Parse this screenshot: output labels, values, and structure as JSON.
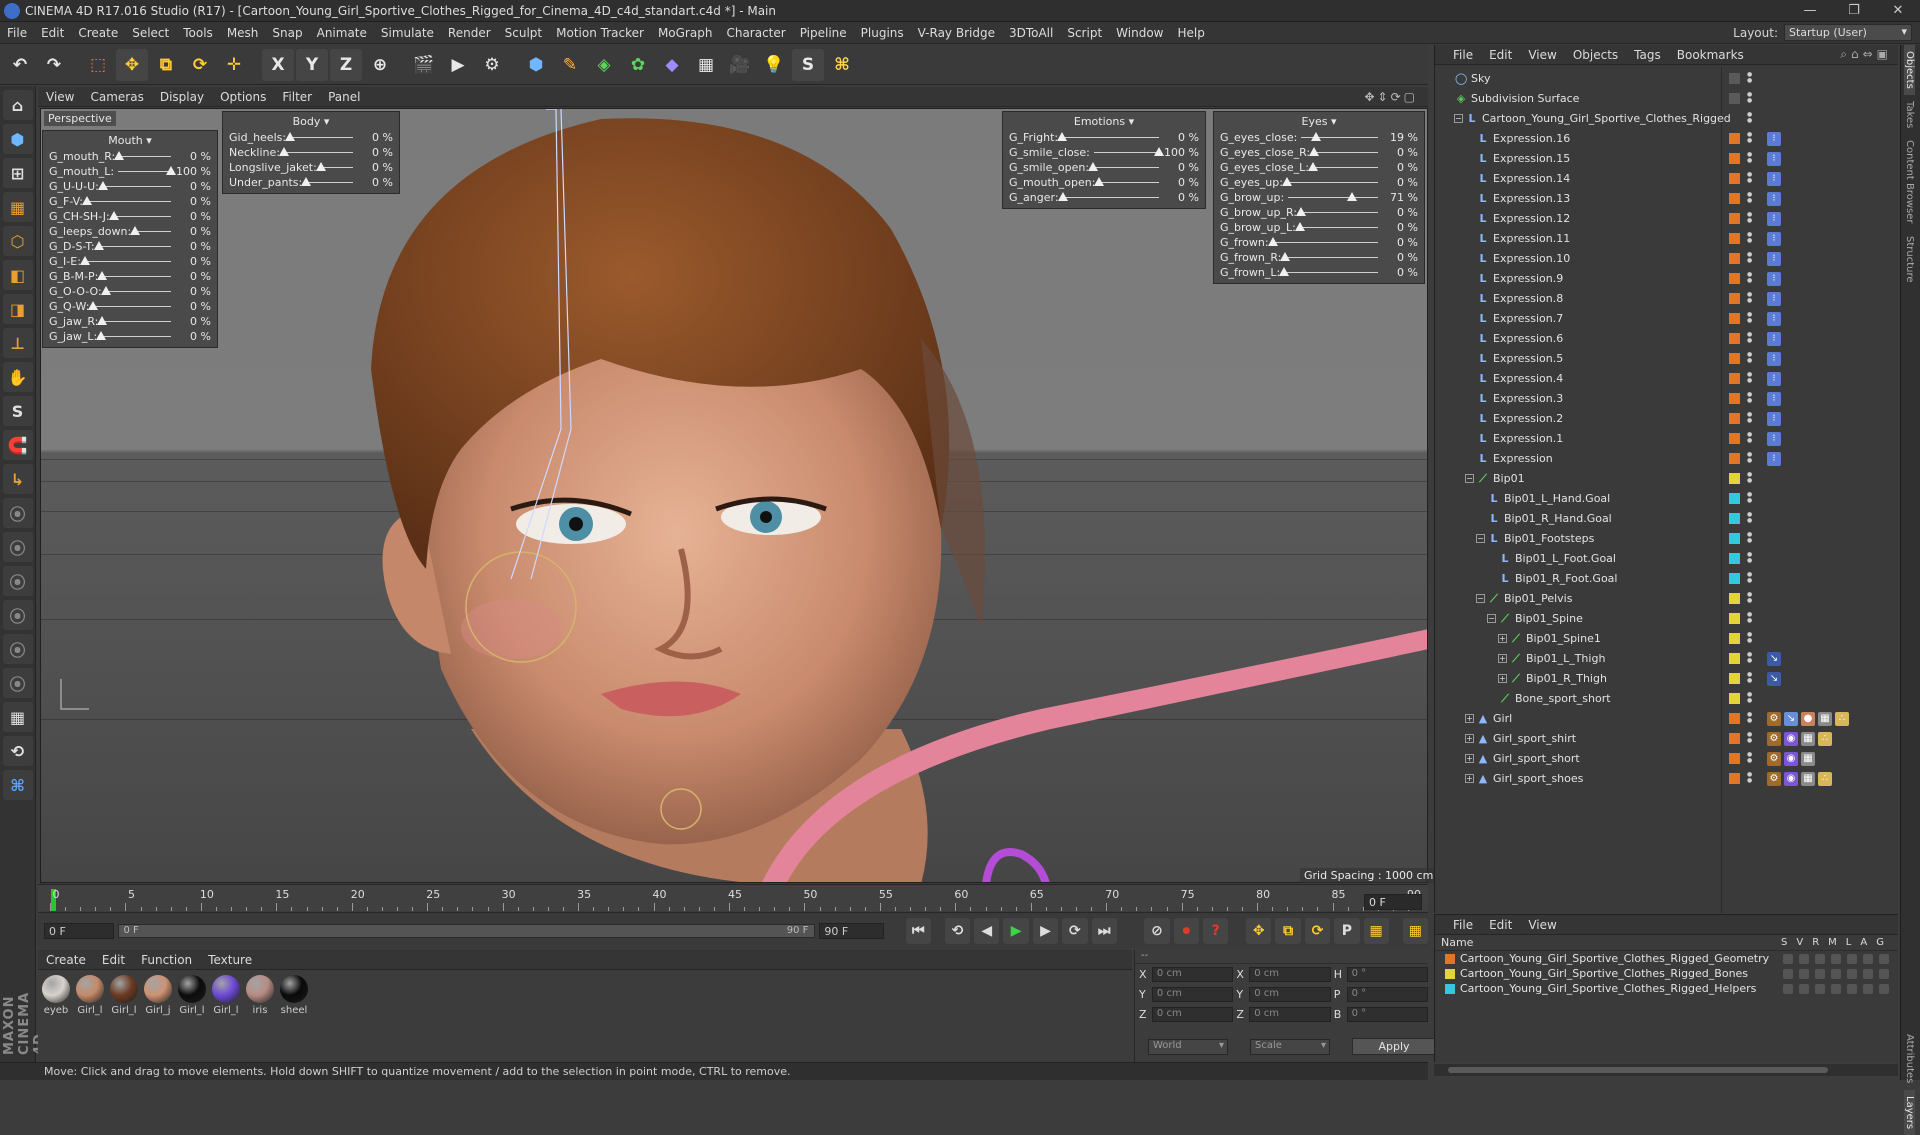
{
  "window": {
    "title": "CINEMA 4D R17.016 Studio (R17) - [Cartoon_Young_Girl_Sportive_Clothes_Rigged_for_Cinema_4D_c4d_standart.c4d *] - Main",
    "controls": [
      "—",
      "❐",
      "✕"
    ]
  },
  "menu": {
    "items": [
      "File",
      "Edit",
      "Create",
      "Select",
      "Tools",
      "Mesh",
      "Snap",
      "Animate",
      "Simulate",
      "Render",
      "Sculpt",
      "Motion Tracker",
      "MoGraph",
      "Character",
      "Pipeline",
      "Plugins",
      "V-Ray Bridge",
      "3DToAll",
      "Script",
      "Window",
      "Help"
    ],
    "layout_label": "Layout:",
    "layout_value": "Startup (User)"
  },
  "toolbar": {
    "undo": "↶",
    "redo": "↷",
    "select": "⬚",
    "move": "✥",
    "scale": "⧉",
    "rotate": "⟳",
    "transform": "✛",
    "x_axis": "X",
    "y_axis": "Y",
    "z_axis": "Z",
    "world": "⊕",
    "render_view": "🎬",
    "render": "▶",
    "render_settings": "⚙",
    "cube": "⬢",
    "pen": "✎",
    "subdiv": "◈",
    "array": "✿",
    "deformer": "◆",
    "floor": "▦",
    "camera": "🎥",
    "light": "💡",
    "sculpt_s": "S",
    "python": "⌘"
  },
  "left_tools": [
    "⌂",
    "⬢",
    "⊞",
    "▦",
    "⬡",
    "◧",
    "◨",
    "⊥",
    "✋",
    "S",
    "🧲",
    "↳",
    "⦿",
    "⦿",
    "⦿",
    "⦿",
    "⦿",
    "⦿",
    "▦",
    "⟲",
    "⌘"
  ],
  "maxon_text": "MAXON CINEMA 4D",
  "viewport": {
    "menu": [
      "View",
      "Cameras",
      "Display",
      "Options",
      "Filter",
      "Panel"
    ],
    "nav_icons": "✥⇕⟳▢",
    "label": "Perspective",
    "grid_spacing": "Grid Spacing : 1000 cm"
  },
  "panels": {
    "mouth": {
      "title": "Mouth ▾",
      "rows": [
        {
          "name": "G_mouth_R:",
          "pct": "0 %",
          "val": 0
        },
        {
          "name": "G_mouth_L:",
          "pct": "100 %",
          "val": 100
        },
        {
          "name": "G_U-U-U:",
          "pct": "0 %",
          "val": 0
        },
        {
          "name": "G_F-V:",
          "pct": "0 %",
          "val": 0
        },
        {
          "name": "G_CH-SH-J:",
          "pct": "0 %",
          "val": 0
        },
        {
          "name": "G_leeps_down:",
          "pct": "0 %",
          "val": 0
        },
        {
          "name": "G_D-S-T:",
          "pct": "0 %",
          "val": 0
        },
        {
          "name": "G_I-E:",
          "pct": "0 %",
          "val": 0
        },
        {
          "name": "G_B-M-P:",
          "pct": "0 %",
          "val": 0
        },
        {
          "name": "G_O-O-O:",
          "pct": "0 %",
          "val": 0
        },
        {
          "name": "G_Q-W:",
          "pct": "0 %",
          "val": 0
        },
        {
          "name": "G_jaw_R:",
          "pct": "0 %",
          "val": 0
        },
        {
          "name": "G_jaw_L:",
          "pct": "0 %",
          "val": 0
        }
      ]
    },
    "body": {
      "title": "Body ▾",
      "rows": [
        {
          "name": "Gid_heels:",
          "pct": "0 %",
          "val": 0
        },
        {
          "name": "Neckline:",
          "pct": "0 %",
          "val": 0
        },
        {
          "name": "Longslive_jaket:",
          "pct": "0 %",
          "val": 0
        },
        {
          "name": "Under_pants:",
          "pct": "0 %",
          "val": 0
        }
      ]
    },
    "emotions": {
      "title": "Emotions ▾",
      "rows": [
        {
          "name": "G_Fright:",
          "pct": "0 %",
          "val": 0
        },
        {
          "name": "G_smile_close:",
          "pct": "100 %",
          "val": 100
        },
        {
          "name": "G_smile_open:",
          "pct": "0 %",
          "val": 0
        },
        {
          "name": "G_mouth_open:",
          "pct": "0 %",
          "val": 0
        },
        {
          "name": "G_anger:",
          "pct": "0 %",
          "val": 0
        }
      ]
    },
    "eyes": {
      "title": "Eyes ▾",
      "rows": [
        {
          "name": "G_eyes_close:",
          "pct": "19 %",
          "val": 19
        },
        {
          "name": "G_eyes_close_R:",
          "pct": "0 %",
          "val": 0
        },
        {
          "name": "G_eyes_close_L:",
          "pct": "0 %",
          "val": 0
        },
        {
          "name": "G_eyes_up:",
          "pct": "0 %",
          "val": 0
        },
        {
          "name": "G_brow_up:",
          "pct": "71 %",
          "val": 71
        },
        {
          "name": "G_brow_up_R:",
          "pct": "0 %",
          "val": 0
        },
        {
          "name": "G_brow_up_L:",
          "pct": "0 %",
          "val": 0
        },
        {
          "name": "G_frown:",
          "pct": "0 %",
          "val": 0
        },
        {
          "name": "G_frown_R:",
          "pct": "0 %",
          "val": 0
        },
        {
          "name": "G_frown_L:",
          "pct": "0 %",
          "val": 0
        }
      ]
    }
  },
  "timeline": {
    "ticks": [
      "0",
      "5",
      "10",
      "15",
      "20",
      "25",
      "30",
      "35",
      "40",
      "45",
      "50",
      "55",
      "60",
      "65",
      "70",
      "75",
      "80",
      "85",
      "90"
    ],
    "current": "0 F"
  },
  "transport": {
    "start": "0 F",
    "range_start": "0 F",
    "range_end": "90 F",
    "end": "90 F",
    "buttons": [
      "⏮",
      "⟲",
      "◀",
      "▶",
      "▶",
      "⟳",
      "⏭"
    ],
    "rec_buttons": [
      "⊘",
      "⏺",
      "?",
      "✥",
      "⧉",
      "⟳",
      "P",
      "▦",
      "▦"
    ]
  },
  "materials": {
    "menu": [
      "Create",
      "Edit",
      "Function",
      "Texture"
    ],
    "items": [
      {
        "label": "eyeb",
        "color": "#d8d2cc"
      },
      {
        "label": "Girl_l",
        "color": "#c58a69"
      },
      {
        "label": "Girl_l",
        "color": "#6b3b22"
      },
      {
        "label": "Girl_j",
        "color": "#cf9274"
      },
      {
        "label": "Girl_l",
        "color": "#0c0c0c"
      },
      {
        "label": "Girl_l",
        "color": "#6d4ad6"
      },
      {
        "label": "iris",
        "color": "#b88b84"
      },
      {
        "label": "sheel",
        "color": "#090909"
      }
    ]
  },
  "coords": {
    "header": "--",
    "rows": [
      {
        "a1": "X",
        "v1": "0 cm",
        "a2": "X",
        "v2": "0 cm",
        "a3": "H",
        "v3": "0 °"
      },
      {
        "a1": "Y",
        "v1": "0 cm",
        "a2": "Y",
        "v2": "0 cm",
        "a3": "P",
        "v3": "0 °"
      },
      {
        "a1": "Z",
        "v1": "0 cm",
        "a2": "Z",
        "v2": "0 cm",
        "a3": "B",
        "v3": "0 °"
      }
    ],
    "mode": "World",
    "mode2": "Scale",
    "apply": "Apply"
  },
  "status": "Move: Click and drag to move elements. Hold down SHIFT to quantize movement / add to the selection in point mode, CTRL to remove.",
  "objects": {
    "menu": [
      "File",
      "Edit",
      "View",
      "Objects",
      "Tags",
      "Bookmarks"
    ],
    "tools": "⌕⌂⇔▣",
    "rows": [
      {
        "name": "Sky",
        "indent": 0,
        "plus": "",
        "icon": "◯",
        "icolor": "#8fc3ff",
        "layer": "#5a5a5a",
        "tags": []
      },
      {
        "name": "Subdivision Surface",
        "indent": 0,
        "plus": "",
        "icon": "◈",
        "icolor": "#58c858",
        "layer": "#5a5a5a",
        "tags": []
      },
      {
        "name": "Cartoon_Young_Girl_Sportive_Clothes_Rigged",
        "indent": 1,
        "plus": "−",
        "icon": "L",
        "icolor": "#8fb7ff",
        "layer": "",
        "tags": []
      },
      {
        "name": "Expression.16",
        "indent": 2,
        "plus": "",
        "icon": "L",
        "icolor": "#8fb7ff",
        "layer": "#e0762a",
        "tags": [
          "x"
        ]
      },
      {
        "name": "Expression.15",
        "indent": 2,
        "plus": "",
        "icon": "L",
        "icolor": "#8fb7ff",
        "layer": "#e0762a",
        "tags": [
          "x"
        ]
      },
      {
        "name": "Expression.14",
        "indent": 2,
        "plus": "",
        "icon": "L",
        "icolor": "#8fb7ff",
        "layer": "#e0762a",
        "tags": [
          "x"
        ]
      },
      {
        "name": "Expression.13",
        "indent": 2,
        "plus": "",
        "icon": "L",
        "icolor": "#8fb7ff",
        "layer": "#e0762a",
        "tags": [
          "x"
        ]
      },
      {
        "name": "Expression.12",
        "indent": 2,
        "plus": "",
        "icon": "L",
        "icolor": "#8fb7ff",
        "layer": "#e0762a",
        "tags": [
          "x"
        ]
      },
      {
        "name": "Expression.11",
        "indent": 2,
        "plus": "",
        "icon": "L",
        "icolor": "#8fb7ff",
        "layer": "#e0762a",
        "tags": [
          "x"
        ]
      },
      {
        "name": "Expression.10",
        "indent": 2,
        "plus": "",
        "icon": "L",
        "icolor": "#8fb7ff",
        "layer": "#e0762a",
        "tags": [
          "x"
        ]
      },
      {
        "name": "Expression.9",
        "indent": 2,
        "plus": "",
        "icon": "L",
        "icolor": "#8fb7ff",
        "layer": "#e0762a",
        "tags": [
          "x"
        ]
      },
      {
        "name": "Expression.8",
        "indent": 2,
        "plus": "",
        "icon": "L",
        "icolor": "#8fb7ff",
        "layer": "#e0762a",
        "tags": [
          "x"
        ]
      },
      {
        "name": "Expression.7",
        "indent": 2,
        "plus": "",
        "icon": "L",
        "icolor": "#8fb7ff",
        "layer": "#e0762a",
        "tags": [
          "x"
        ]
      },
      {
        "name": "Expression.6",
        "indent": 2,
        "plus": "",
        "icon": "L",
        "icolor": "#8fb7ff",
        "layer": "#e0762a",
        "tags": [
          "x"
        ]
      },
      {
        "name": "Expression.5",
        "indent": 2,
        "plus": "",
        "icon": "L",
        "icolor": "#8fb7ff",
        "layer": "#e0762a",
        "tags": [
          "x"
        ]
      },
      {
        "name": "Expression.4",
        "indent": 2,
        "plus": "",
        "icon": "L",
        "icolor": "#8fb7ff",
        "layer": "#e0762a",
        "tags": [
          "x"
        ]
      },
      {
        "name": "Expression.3",
        "indent": 2,
        "plus": "",
        "icon": "L",
        "icolor": "#8fb7ff",
        "layer": "#e0762a",
        "tags": [
          "x"
        ]
      },
      {
        "name": "Expression.2",
        "indent": 2,
        "plus": "",
        "icon": "L",
        "icolor": "#8fb7ff",
        "layer": "#e0762a",
        "tags": [
          "x"
        ]
      },
      {
        "name": "Expression.1",
        "indent": 2,
        "plus": "",
        "icon": "L",
        "icolor": "#8fb7ff",
        "layer": "#e0762a",
        "tags": [
          "x"
        ]
      },
      {
        "name": "Expression",
        "indent": 2,
        "plus": "",
        "icon": "L",
        "icolor": "#8fb7ff",
        "layer": "#e0762a",
        "tags": [
          "x"
        ]
      },
      {
        "name": "Bip01",
        "indent": 2,
        "plus": "−",
        "icon": "⟋",
        "icolor": "#5cd65c",
        "layer": "#e3d43a",
        "tags": []
      },
      {
        "name": "Bip01_L_Hand.Goal",
        "indent": 3,
        "plus": "",
        "icon": "L",
        "icolor": "#8fb7ff",
        "layer": "#35c6e0",
        "tags": []
      },
      {
        "name": "Bip01_R_Hand.Goal",
        "indent": 3,
        "plus": "",
        "icon": "L",
        "icolor": "#8fb7ff",
        "layer": "#35c6e0",
        "tags": []
      },
      {
        "name": "Bip01_Footsteps",
        "indent": 3,
        "plus": "−",
        "icon": "L",
        "icolor": "#8fb7ff",
        "layer": "#35c6e0",
        "tags": []
      },
      {
        "name": "Bip01_L_Foot.Goal",
        "indent": 4,
        "plus": "",
        "icon": "L",
        "icolor": "#8fb7ff",
        "layer": "#35c6e0",
        "tags": []
      },
      {
        "name": "Bip01_R_Foot.Goal",
        "indent": 4,
        "plus": "",
        "icon": "L",
        "icolor": "#8fb7ff",
        "layer": "#35c6e0",
        "tags": []
      },
      {
        "name": "Bip01_Pelvis",
        "indent": 3,
        "plus": "−",
        "icon": "⟋",
        "icolor": "#5cd65c",
        "layer": "#e3d43a",
        "tags": []
      },
      {
        "name": "Bip01_Spine",
        "indent": 4,
        "plus": "−",
        "icon": "⟋",
        "icolor": "#5cd65c",
        "layer": "#e3d43a",
        "tags": []
      },
      {
        "name": "Bip01_Spine1",
        "indent": 5,
        "plus": "+",
        "icon": "⟋",
        "icolor": "#5cd65c",
        "layer": "#e3d43a",
        "tags": []
      },
      {
        "name": "Bip01_L_Thigh",
        "indent": 5,
        "plus": "+",
        "icon": "⟋",
        "icolor": "#5cd65c",
        "layer": "#e3d43a",
        "tags": [
          "ik"
        ]
      },
      {
        "name": "Bip01_R_Thigh",
        "indent": 5,
        "plus": "+",
        "icon": "⟋",
        "icolor": "#5cd65c",
        "layer": "#e3d43a",
        "tags": [
          "ik"
        ]
      },
      {
        "name": "Bone_sport_short",
        "indent": 4,
        "plus": "",
        "icon": "⟋",
        "icolor": "#5cd65c",
        "layer": "#e3d43a",
        "tags": []
      },
      {
        "name": "Girl",
        "indent": 2,
        "plus": "+",
        "icon": "▲",
        "icolor": "#8fb7ff",
        "layer": "#e0762a",
        "tags": [
          "w",
          "s",
          "m",
          "c",
          "d"
        ]
      },
      {
        "name": "Girl_sport_shirt",
        "indent": 2,
        "plus": "+",
        "icon": "▲",
        "icolor": "#8fb7ff",
        "layer": "#e0762a",
        "tags": [
          "w",
          "p",
          "c",
          "d"
        ]
      },
      {
        "name": "Girl_sport_short",
        "indent": 2,
        "plus": "+",
        "icon": "▲",
        "icolor": "#8fb7ff",
        "layer": "#e0762a",
        "tags": [
          "w",
          "p",
          "c"
        ]
      },
      {
        "name": "Girl_sport_shoes",
        "indent": 2,
        "plus": "+",
        "icon": "▲",
        "icolor": "#8fb7ff",
        "layer": "#e0762a",
        "tags": [
          "w",
          "p",
          "c",
          "d"
        ]
      }
    ]
  },
  "layers": {
    "menu": [
      "File",
      "Edit",
      "View"
    ],
    "header": "Name",
    "cols": [
      "S",
      "V",
      "R",
      "M",
      "L",
      "A",
      "G"
    ],
    "rows": [
      {
        "name": "Cartoon_Young_Girl_Sportive_Clothes_Rigged_Geometry",
        "color": "#e0762a"
      },
      {
        "name": "Cartoon_Young_Girl_Sportive_Clothes_Rigged_Bones",
        "color": "#e3d43a"
      },
      {
        "name": "Cartoon_Young_Girl_Sportive_Clothes_Rigged_Helpers",
        "color": "#35c6e0"
      }
    ]
  },
  "right_tabs": [
    "Objects",
    "Takes",
    "Content Browser",
    "Structure",
    "Attributes",
    "Layers"
  ]
}
